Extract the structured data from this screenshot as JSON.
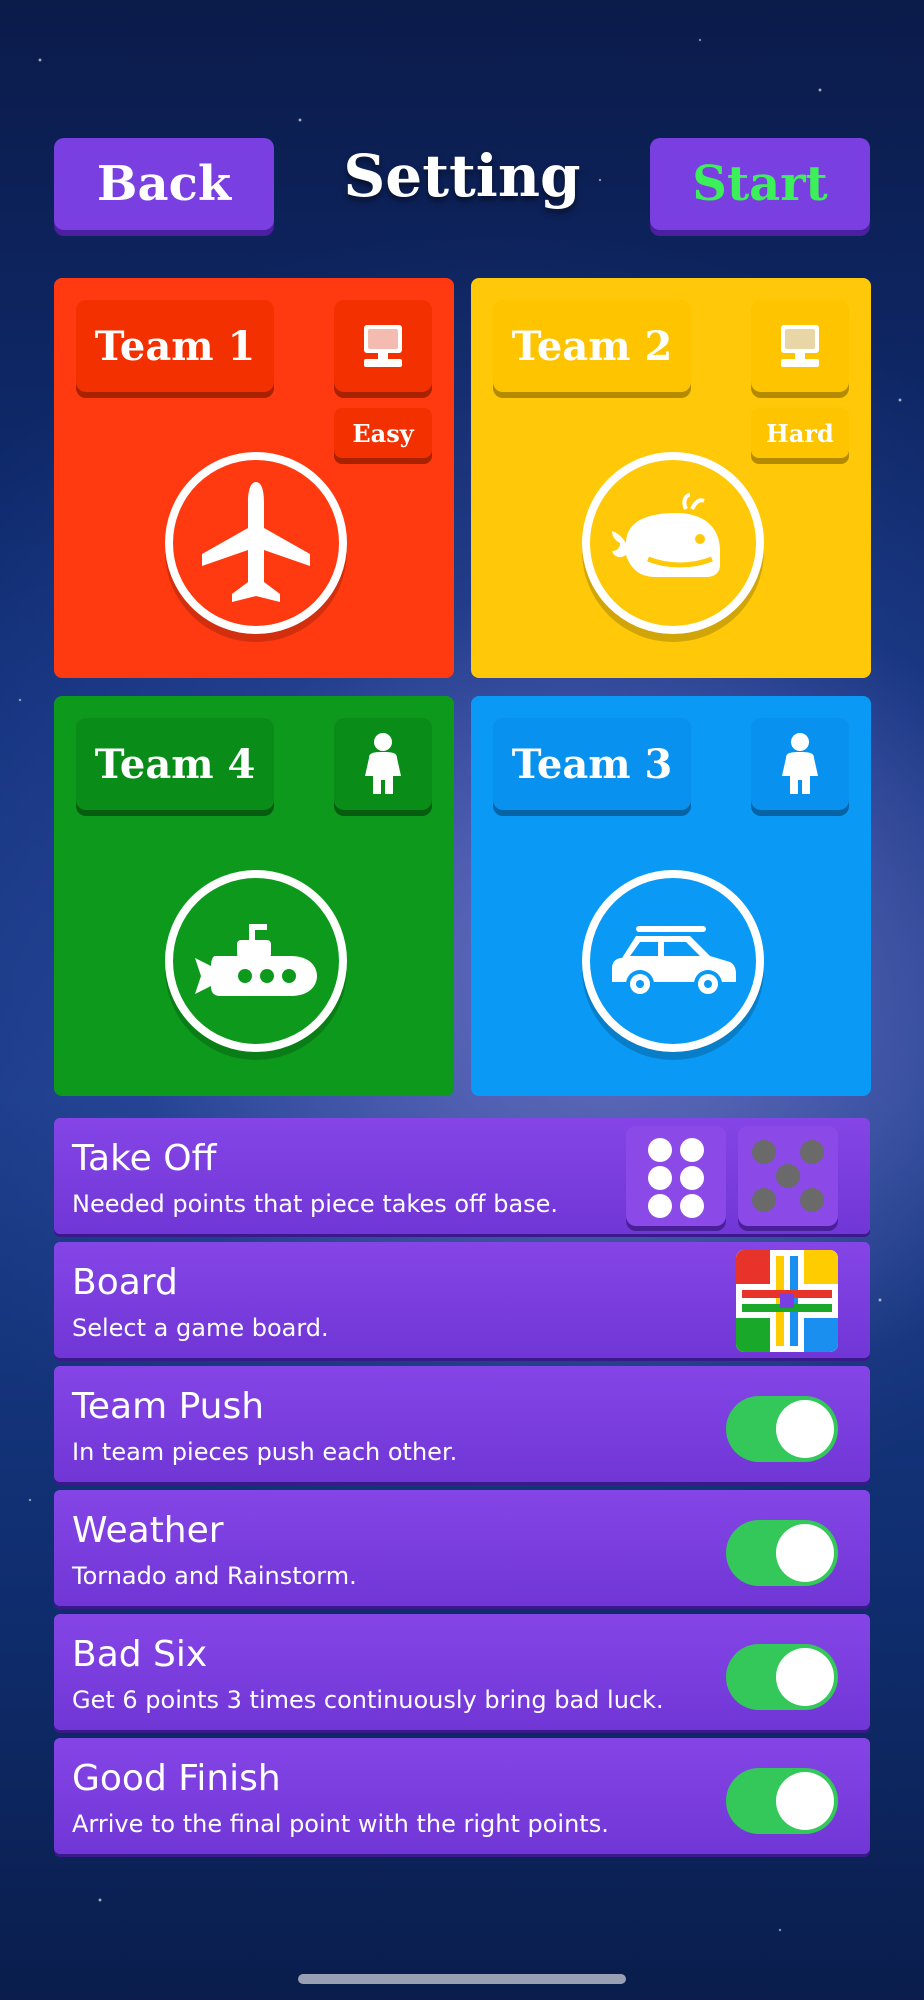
{
  "header": {
    "back_label": "Back",
    "title": "Setting",
    "start_label": "Start"
  },
  "teams": [
    {
      "label": "Team 1",
      "player_type": "computer",
      "level": "Easy",
      "emblem": "airplane-icon",
      "color": "#ff3a10"
    },
    {
      "label": "Team 2",
      "player_type": "computer",
      "level": "Hard",
      "emblem": "whale-icon",
      "color": "#ffc90a"
    },
    {
      "label": "Team 4",
      "player_type": "human",
      "emblem": "submarine-icon",
      "color": "#0d9a1c"
    },
    {
      "label": "Team 3",
      "player_type": "human",
      "emblem": "car-icon",
      "color": "#0a9af5"
    }
  ],
  "settings": [
    {
      "title": "Take Off",
      "desc": "Needed points that piece takes off base.",
      "options": [
        "6",
        "5"
      ]
    },
    {
      "title": "Board",
      "desc": "Select a game board."
    },
    {
      "title": "Team Push",
      "desc": "In team pieces push each other.",
      "enabled": true
    },
    {
      "title": "Weather",
      "desc": "Tornado and Rainstorm.",
      "enabled": true
    },
    {
      "title": "Bad Six",
      "desc": "Get 6 points 3 times continuously bring bad luck.",
      "enabled": true
    },
    {
      "title": "Good Finish",
      "desc": "Arrive to the final point with the right points.",
      "enabled": true
    }
  ],
  "colors": {
    "accent": "#7a3fe0",
    "start_text": "#3cf05a",
    "toggle_on": "#34c759"
  }
}
